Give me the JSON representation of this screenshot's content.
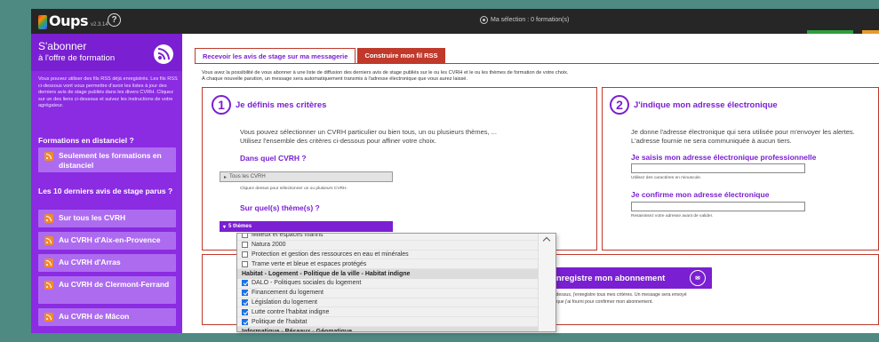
{
  "app": {
    "name": "Oups",
    "version": "v2.3.14",
    "help": "?"
  },
  "selection": {
    "label": "Ma sélection : 0 formation(s)"
  },
  "sidebar": {
    "title": "S'abonner",
    "subtitle": "à l'offre de formation",
    "intro": "Vous pouvez utiliser des fils RSS déjà enregistrés. Les fils RSS ci-dessous vont vous permettre d'avoir les listes à jour des derniers avis de stage publiés dans les divers CVRH. Cliquez sur un des liens ci-dessous et suivez les instructions de votre agrégateur.",
    "section1": "Formations en distanciel ?",
    "distanciel_link": "Seulement les formations en distanciel",
    "section2": "Les 10 derniers avis de stage parus ?",
    "links": [
      "Sur tous les CVRH",
      "Au CVRH d'Aix-en-Provence",
      "Au CVRH d'Arras",
      "Au CVRH de Clermont-Ferrand",
      "Au CVRH de Mâcon"
    ]
  },
  "tabs": [
    "Recevoir les avis de stage sur ma messagerie",
    "Construire mon fil RSS"
  ],
  "intro": {
    "line1": "Vous avez la possibilité de vous abonner à une liste de diffusion des derniers avis de stage publiés sur le ou les CVRH et le ou les thèmes de formation de votre choix.",
    "line2": "À chaque nouvelle parution, un message sera automatiquement transmis à l'adresse électronique que vous aurez laissé."
  },
  "criteria": {
    "number": "1",
    "title": "Je définis mes critères",
    "para1": "Vous pouvez sélectionner un CVRH particulier ou bien tous, un ou plusieurs thèmes, ...",
    "para2": "Utilisez l'ensemble des critères ci-dessous pour affiner votre choix.",
    "cvrh_question": "Dans quel CVRH ?",
    "cvrh_value": "Tous les CVRH",
    "cvrh_hint": "Cliquez dessus pour sélectionner un ou plusieurs CVRH.",
    "theme_question": "Sur quel(s) thème(s) ?",
    "theme_value": "5 thèmes"
  },
  "email": {
    "number": "2",
    "title": "J'indique mon adresse électronique",
    "para1": "Je donne l'adresse électronique qui sera utilisée pour m'envoyer les alertes.",
    "para2": "L'adresse fournie ne sera communiquée à aucun tiers.",
    "label1": "Je saisis mon adresse électronique professionnelle",
    "hint1": "Utilisez des caractères en minuscule.",
    "label2": "Je confirme mon adresse électronique",
    "hint2": "Resaisissez votre adresse avant de valider."
  },
  "register": {
    "label": "J'enregistre mon abonnement",
    "note1": "ci-dessus, j'enregistre tous mes critères. Un message sera envoyé",
    "note2": "que j'ai fourni pour confirmer mon abonnement."
  },
  "dropdown": {
    "items": [
      {
        "label": "Milieux et espaces marins",
        "checked": false,
        "group": false
      },
      {
        "label": "Natura 2000",
        "checked": false,
        "group": false
      },
      {
        "label": "Protection et gestion des ressources en eau et minérales",
        "checked": false,
        "group": false
      },
      {
        "label": "Trame verte et bleue et espaces protégés",
        "checked": false,
        "group": false
      },
      {
        "label": "Habitat - Logement - Politique de la ville - Habitat indigne",
        "checked": false,
        "group": true
      },
      {
        "label": "DALO - Politiques sociales du logement",
        "checked": true,
        "group": false
      },
      {
        "label": "Financement du logement",
        "checked": true,
        "group": false
      },
      {
        "label": "Législation du logement",
        "checked": true,
        "group": false
      },
      {
        "label": "Lutte contre l'habitat indigne",
        "checked": true,
        "group": false
      },
      {
        "label": "Politique de l'habitat",
        "checked": true,
        "group": false
      },
      {
        "label": "Informatique - Réseaux - Géomatique",
        "checked": false,
        "group": true
      }
    ]
  },
  "colors": {
    "purple": "#7a1fd1",
    "sidebar": "#8b2be2",
    "red": "#c0392b",
    "rss_orange": "#f38a2a"
  }
}
